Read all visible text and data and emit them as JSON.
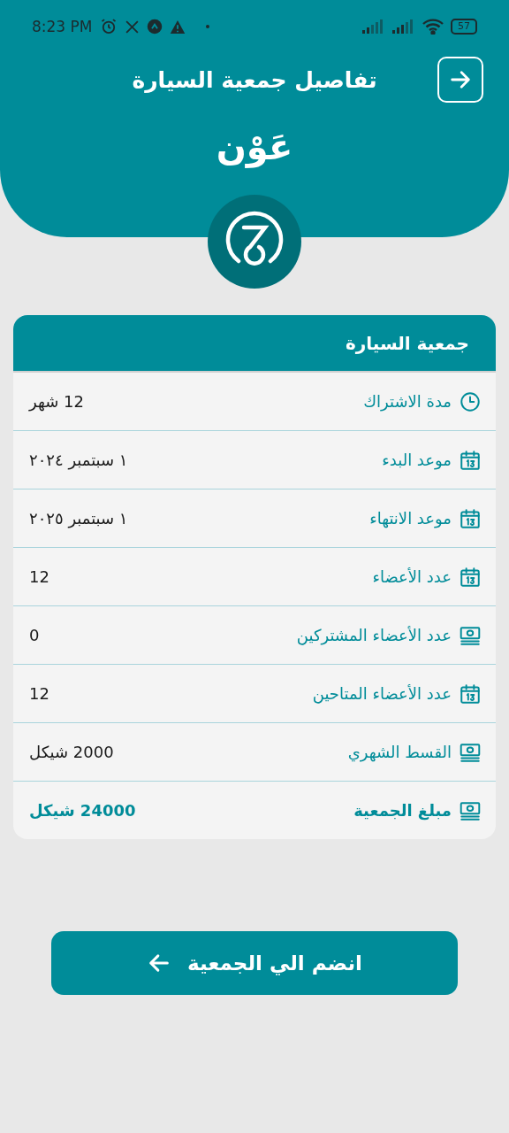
{
  "status_bar": {
    "time": "8:23 PM",
    "battery": "57"
  },
  "header": {
    "title": "تفاصيل جمعية السيارة",
    "brand": "عَوْن"
  },
  "card": {
    "title": "جمعية السيارة",
    "rows": [
      {
        "kind": "clock",
        "label": "مدة الاشتراك",
        "value": "12 شهر",
        "bold": false
      },
      {
        "kind": "calendar",
        "label": "موعد البدء",
        "value": "١ سبتمبر ٢٠٢٤",
        "bold": false
      },
      {
        "kind": "calendar",
        "label": "موعد الانتهاء",
        "value": "١ سبتمبر ٢٠٢٥",
        "bold": false
      },
      {
        "kind": "calendar",
        "label": "عدد الأعضاء",
        "value": "12",
        "bold": false
      },
      {
        "kind": "money",
        "label": "عدد الأعضاء المشتركين",
        "value": "0",
        "bold": false
      },
      {
        "kind": "calendar",
        "label": "عدد الأعضاء المتاحين",
        "value": "12",
        "bold": false
      },
      {
        "kind": "money",
        "label": "القسط الشهري",
        "value": "2000 شيكل",
        "bold": false
      },
      {
        "kind": "money",
        "label": "مبلغ الجمعية",
        "value": "24000 شيكل",
        "bold": true
      }
    ]
  },
  "join_button": {
    "label": "انضم الي الجمعية"
  }
}
